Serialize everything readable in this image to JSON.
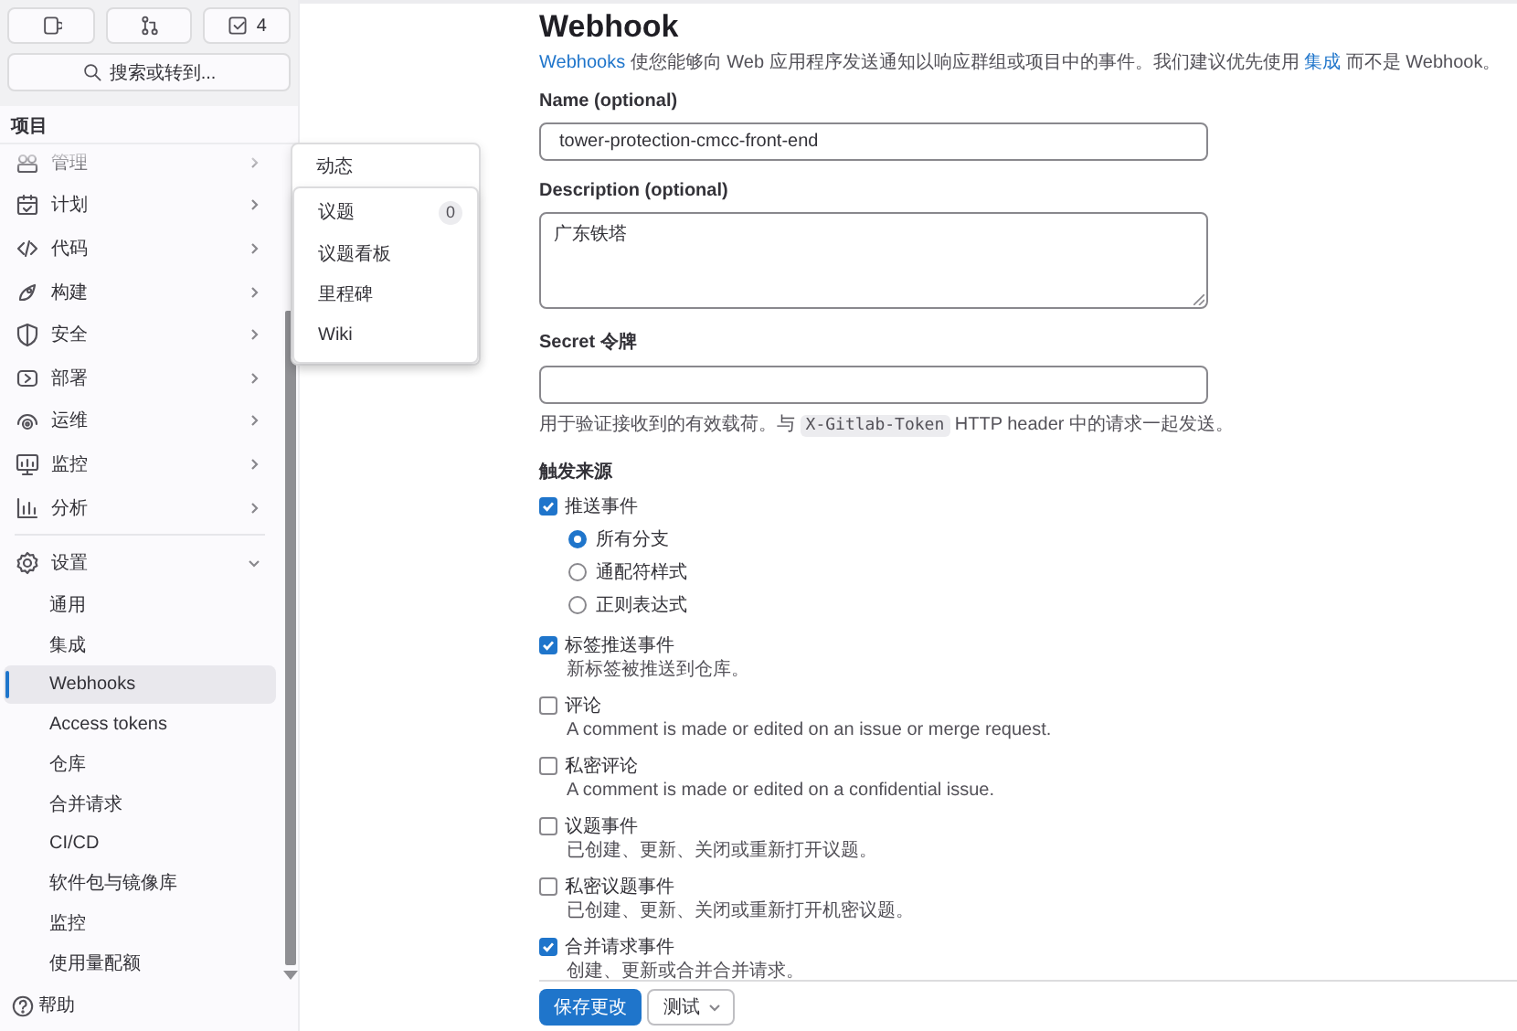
{
  "sidebar": {
    "top_buttons": [
      {
        "kind": "issues"
      },
      {
        "kind": "merge_requests"
      },
      {
        "kind": "todos",
        "count": "4"
      }
    ],
    "search": "搜索或转到...",
    "section": "项目",
    "nav": [
      {
        "label": "管理",
        "kind": "manage",
        "expanded": false
      },
      {
        "label": "计划",
        "kind": "plan",
        "expanded": false
      },
      {
        "label": "代码",
        "kind": "code",
        "expanded": false
      },
      {
        "label": "构建",
        "kind": "build",
        "expanded": false
      },
      {
        "label": "安全",
        "kind": "secure",
        "expanded": false
      },
      {
        "label": "部署",
        "kind": "deploy",
        "expanded": false
      },
      {
        "label": "运维",
        "kind": "operate",
        "expanded": false
      },
      {
        "label": "监控",
        "kind": "monitor",
        "expanded": false
      },
      {
        "label": "分析",
        "kind": "analyze",
        "expanded": false
      },
      {
        "label": "设置",
        "kind": "settings",
        "expanded": true,
        "children": [
          {
            "label": "通用",
            "selected": false
          },
          {
            "label": "集成",
            "selected": false
          },
          {
            "label": "Webhooks",
            "selected": true
          },
          {
            "label": "Access tokens",
            "selected": false
          },
          {
            "label": "仓库",
            "selected": false
          },
          {
            "label": "合并请求",
            "selected": false
          },
          {
            "label": "CI/CD",
            "selected": false
          },
          {
            "label": "软件包与镜像库",
            "selected": false
          },
          {
            "label": "监控",
            "selected": false
          },
          {
            "label": "使用量配额",
            "selected": false
          }
        ]
      }
    ],
    "help": "帮助"
  },
  "flyout": {
    "title": "动态",
    "items": [
      {
        "label": "议题",
        "count": "0"
      },
      {
        "label": "议题看板"
      },
      {
        "label": "里程碑"
      },
      {
        "label": "Wiki"
      }
    ]
  },
  "main": {
    "title": "Webhook",
    "intro": [
      {
        "text": "Webhooks",
        "kind": "link"
      },
      {
        "text": " 使您能够向 Web 应用程序发送通知以响应群组或项目中的事件。我们建议优先使用 ",
        "kind": "text"
      },
      {
        "text": "集成",
        "kind": "link"
      },
      {
        "text": " 而不是 Webhook。",
        "kind": "text"
      }
    ],
    "name": {
      "label": "Name (optional)",
      "value": "tower-protection-cmcc-front-end"
    },
    "description": {
      "label": "Description (optional)",
      "value": "广东铁塔"
    },
    "secret": {
      "label": "Secret 令牌",
      "help": [
        {
          "text": "用于验证接收到的有效载荷。与 ",
          "kind": "text"
        },
        {
          "text": "X-Gitlab-Token",
          "kind": "code"
        },
        {
          "text": " HTTP header 中的请求一起发送。",
          "kind": "text"
        }
      ]
    },
    "triggers": {
      "title": "触发来源",
      "items": [
        {
          "label": "推送事件",
          "checked": true,
          "options": [
            {
              "label": "所有分支",
              "selected": true
            },
            {
              "label": "通配符样式",
              "selected": false
            },
            {
              "label": "正则表达式",
              "selected": false
            }
          ]
        },
        {
          "label": "标签推送事件",
          "checked": true,
          "description": "新标签被推送到仓库。"
        },
        {
          "label": "评论",
          "checked": false,
          "description": "A comment is made or edited on an issue or merge request."
        },
        {
          "label": "私密评论",
          "checked": false,
          "description": "A comment is made or edited on a confidential issue."
        },
        {
          "label": "议题事件",
          "checked": false,
          "description": "已创建、更新、关闭或重新打开议题。"
        },
        {
          "label": "私密议题事件",
          "checked": false,
          "description": "已创建、更新、关闭或重新打开机密议题。"
        },
        {
          "label": "合并请求事件",
          "checked": true,
          "description": "创建、更新或合并合并请求。"
        }
      ]
    },
    "footer": {
      "save": "保存更改",
      "test": "测试"
    }
  }
}
